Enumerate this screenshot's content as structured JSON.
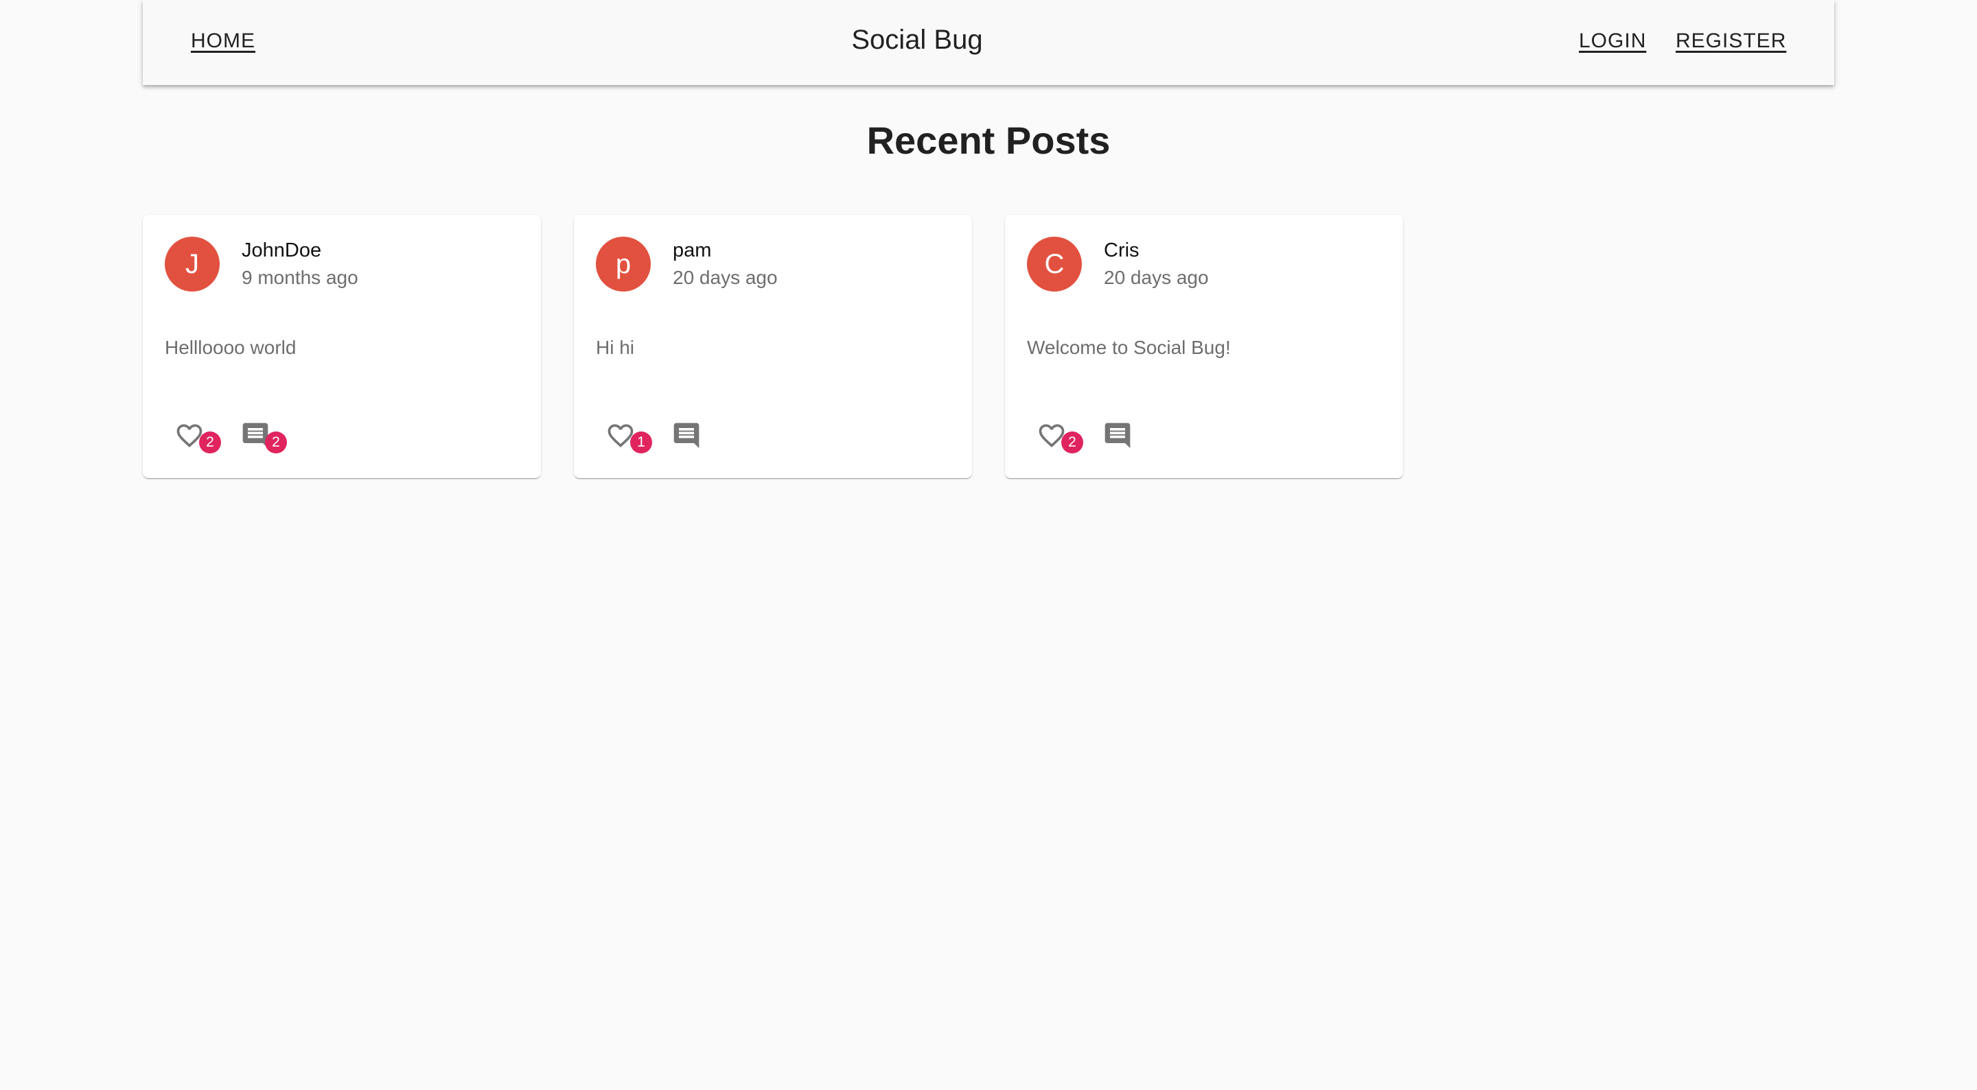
{
  "header": {
    "home_label": "HOME",
    "title": "Social Bug",
    "login_label": "LOGIN",
    "register_label": "REGISTER"
  },
  "main": {
    "heading": "Recent Posts"
  },
  "posts": [
    {
      "avatar_letter": "J",
      "username": "JohnDoe",
      "time": "9 months ago",
      "body": "Hellloooo world",
      "likes": "2",
      "comments": "2"
    },
    {
      "avatar_letter": "p",
      "username": "pam",
      "time": "20 days ago",
      "body": "Hi hi",
      "likes": "1",
      "comments": ""
    },
    {
      "avatar_letter": "C",
      "username": "Cris",
      "time": "20 days ago",
      "body": "Welcome to Social Bug!",
      "likes": "2",
      "comments": ""
    }
  ],
  "icons": {
    "like": "heart-outline-icon",
    "comment": "comment-icon"
  },
  "colors": {
    "avatar": "#e2513f",
    "badge": "#e0245e",
    "icon": "#757575",
    "background": "#fafafa"
  }
}
